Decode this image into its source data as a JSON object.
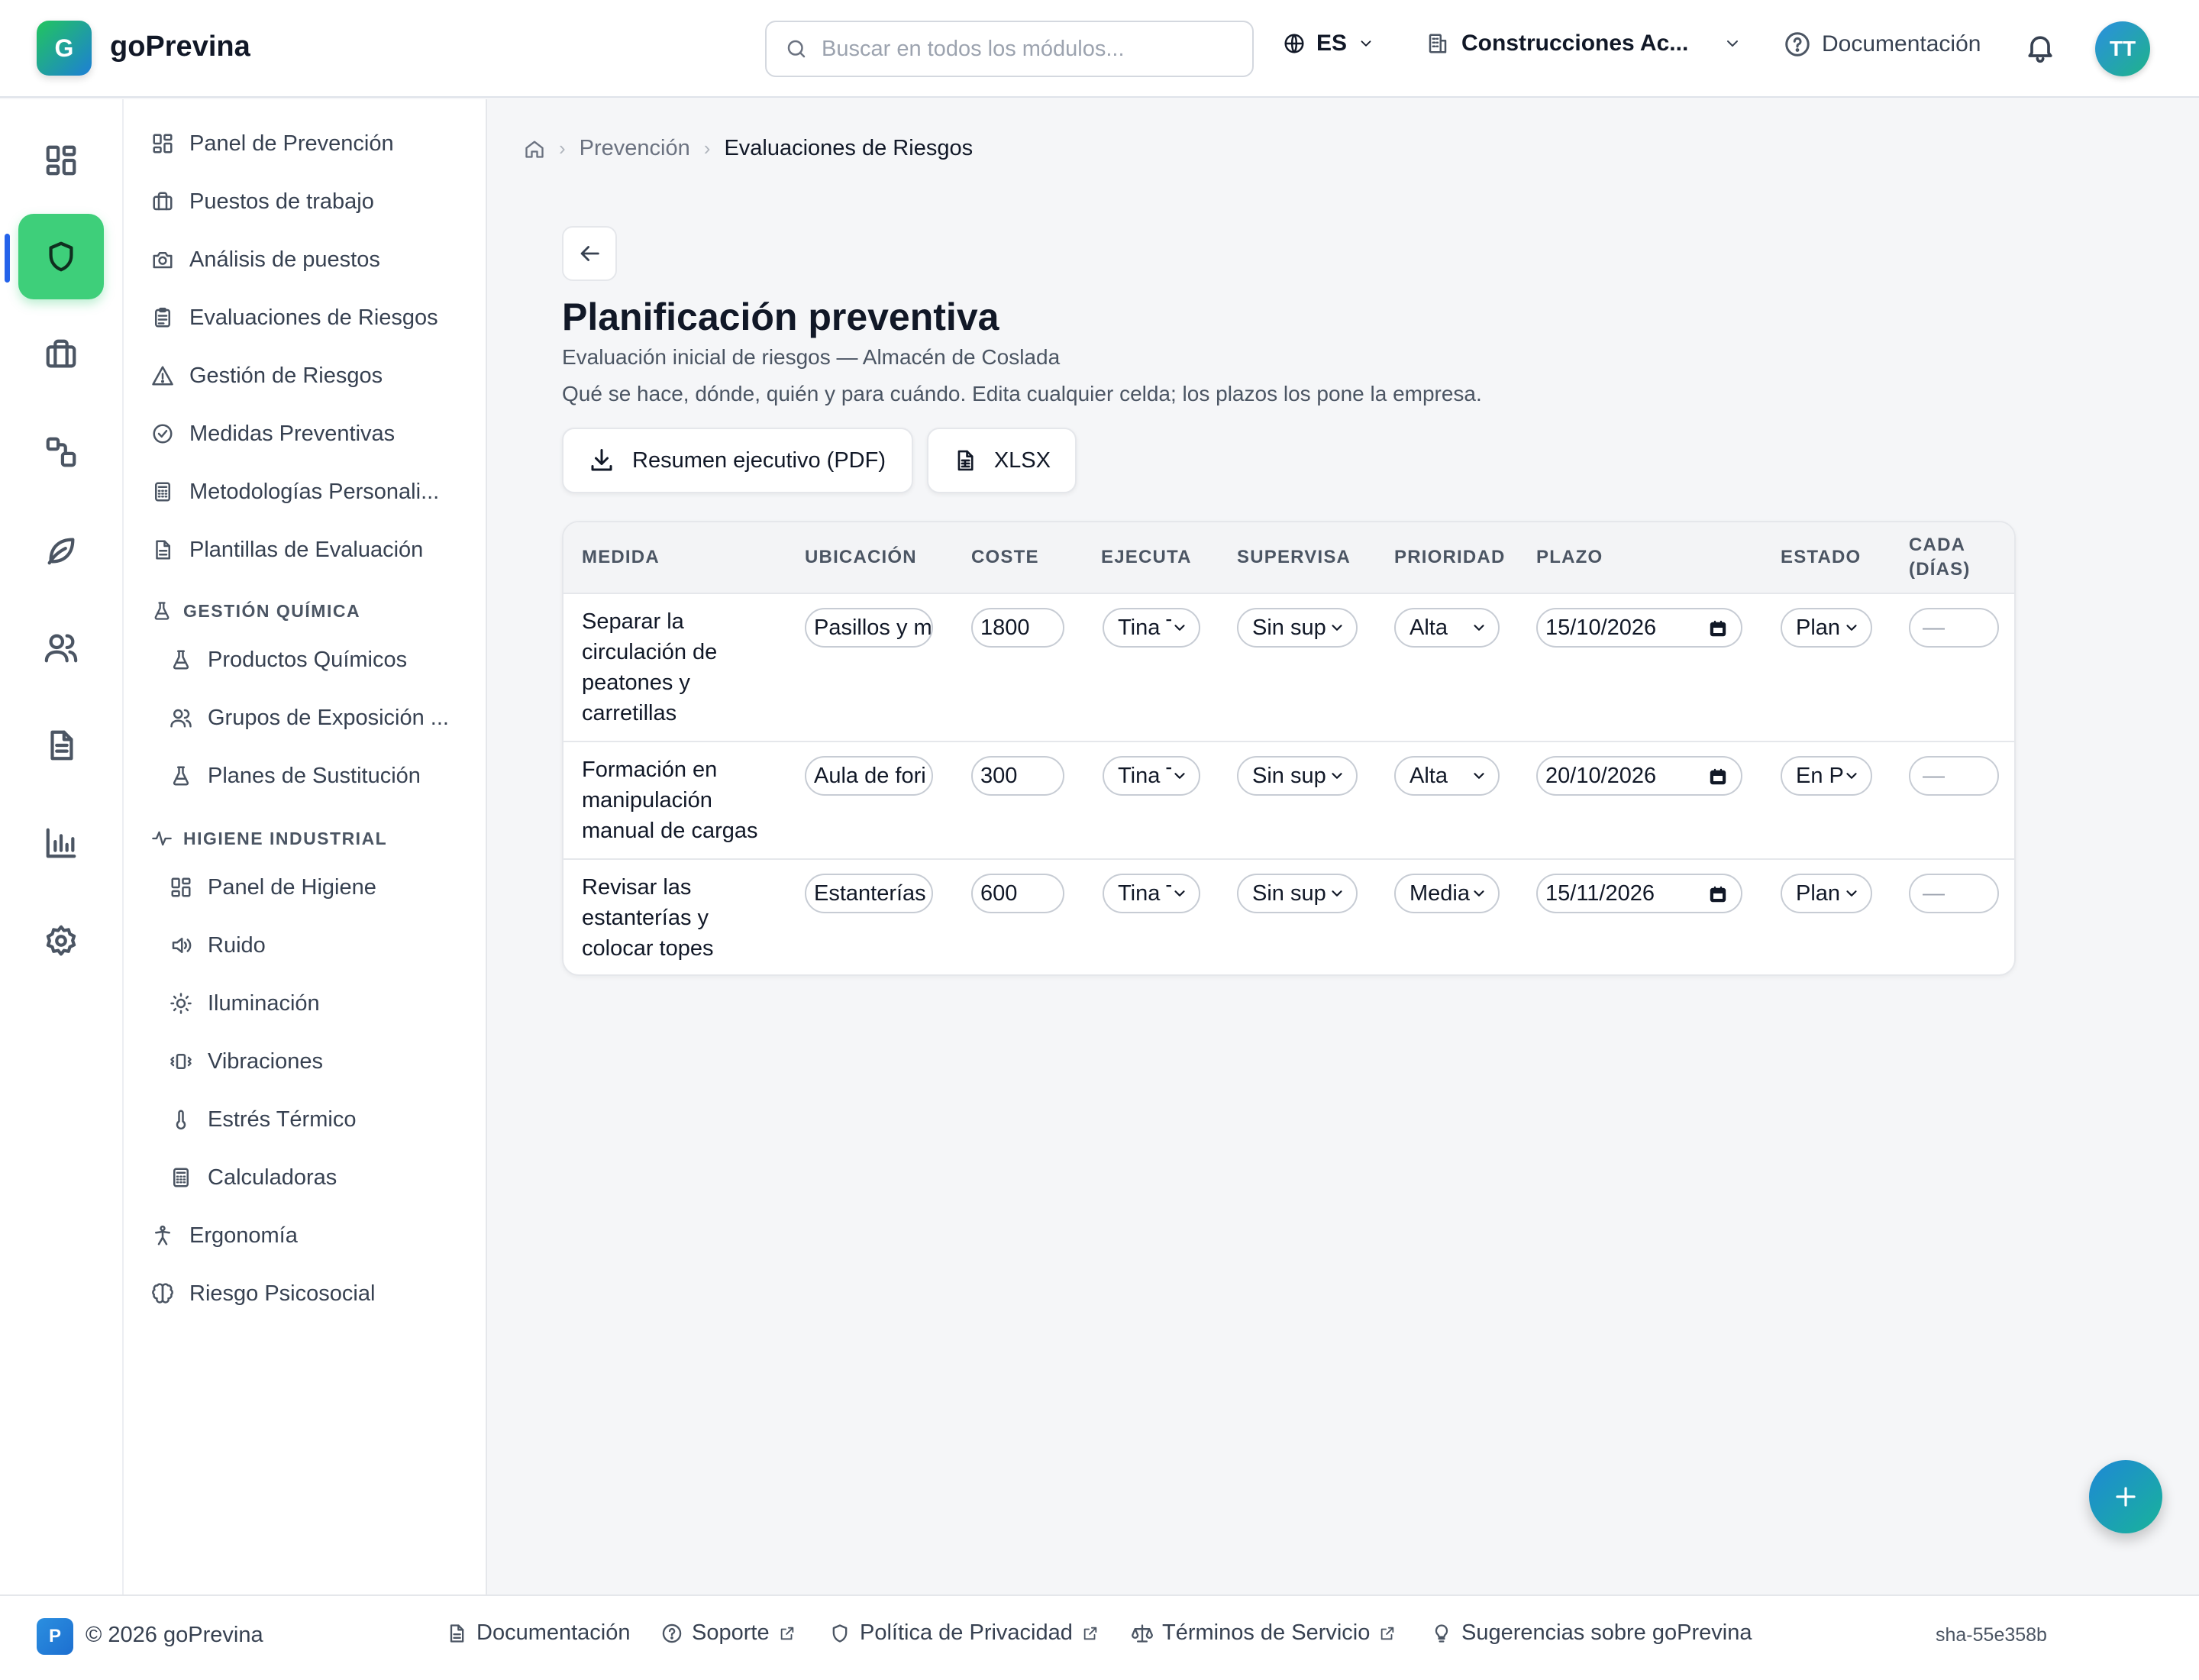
{
  "app": {
    "logo_letter": "G",
    "brand": "goPrevina",
    "search_placeholder": "Buscar en todos los módulos...",
    "language": "ES",
    "company": "Construcciones Ac...",
    "docs_label": "Documentación",
    "avatar_initials": "TT",
    "accent_color": "#3ecf7a",
    "indicator_color": "#2563eb"
  },
  "rail": {
    "items": [
      {
        "icon": "dashboard-icon"
      },
      {
        "icon": "shield-icon",
        "active": true
      },
      {
        "icon": "briefcase-icon"
      },
      {
        "icon": "shapes-icon"
      },
      {
        "icon": "leaf-icon"
      },
      {
        "icon": "users-icon"
      },
      {
        "icon": "document-icon"
      },
      {
        "icon": "bar-chart-icon"
      },
      {
        "icon": "settings-icon"
      }
    ]
  },
  "subnav": {
    "items": [
      {
        "label": "Panel de Prevención",
        "icon": "dashboard-icon"
      },
      {
        "label": "Puestos de trabajo",
        "icon": "briefcase-icon"
      },
      {
        "label": "Análisis de puestos",
        "icon": "camera-icon"
      },
      {
        "label": "Evaluaciones de Riesgos",
        "icon": "clipboard-icon"
      },
      {
        "label": "Gestión de Riesgos",
        "icon": "warning-icon"
      },
      {
        "label": "Medidas Preventivas",
        "icon": "check-circle-icon"
      },
      {
        "label": "Metodologías Personali...",
        "icon": "calculator-icon"
      },
      {
        "label": "Plantillas de Evaluación",
        "icon": "file-icon"
      }
    ],
    "quimica": {
      "title": "GESTIÓN QUÍMICA",
      "items": [
        {
          "label": "Productos Químicos",
          "icon": "flask-icon"
        },
        {
          "label": "Grupos de Exposición ...",
          "icon": "users-icon"
        },
        {
          "label": "Planes de Sustitución",
          "icon": "flask-icon"
        }
      ]
    },
    "higiene": {
      "title": "HIGIENE INDUSTRIAL",
      "items": [
        {
          "label": "Panel de Higiene",
          "icon": "dashboard-icon"
        },
        {
          "label": "Ruido",
          "icon": "speaker-icon"
        },
        {
          "label": "Iluminación",
          "icon": "sun-icon"
        },
        {
          "label": "Vibraciones",
          "icon": "vibration-icon"
        },
        {
          "label": "Estrés Térmico",
          "icon": "thermometer-icon"
        },
        {
          "label": "Calculadoras",
          "icon": "calculator-icon"
        }
      ]
    },
    "extra": [
      {
        "label": "Ergonomía",
        "icon": "person-icon"
      },
      {
        "label": "Riesgo Psicosocial",
        "icon": "brain-icon"
      }
    ]
  },
  "breadcrumb": {
    "home_icon": "home-icon",
    "level1": "Prevención",
    "current": "Evaluaciones de Riesgos"
  },
  "page": {
    "title": "Planificación preventiva",
    "subtitle": "Evaluación inicial de riesgos — Almacén de Coslada",
    "help": "Qué se hace, dónde, quién y para cuándo. Edita cualquier celda; los plazos los pone la empresa.",
    "btn_pdf": "Resumen ejecutivo (PDF)",
    "btn_xlsx": "XLSX"
  },
  "table": {
    "headers": {
      "medida": "MEDIDA",
      "ubicacion": "UBICACIÓN",
      "coste": "COSTE",
      "ejecuta": "EJECUTA",
      "supervisa": "SUPERVISA",
      "prioridad": "PRIORIDAD",
      "plazo": "PLAZO",
      "estado": "ESTADO",
      "cada_1": "CADA",
      "cada_2": "(DÍAS)"
    },
    "rows": [
      {
        "medida": [
          "Separar la",
          "circulación de",
          "peatones y",
          "carretillas"
        ],
        "ubicacion": "Pasillos y m",
        "coste": "1800",
        "ejecuta": "Tina T",
        "supervisa": "Sin sup",
        "prioridad": "Alta",
        "plazo": "15/10/2026",
        "estado": "Plan",
        "cada": "—"
      },
      {
        "medida": [
          "Formación en",
          "manipulación",
          "manual de cargas"
        ],
        "ubicacion": "Aula de fori",
        "coste": "300",
        "ejecuta": "Tina T",
        "supervisa": "Sin sup",
        "prioridad": "Alta",
        "plazo": "20/10/2026",
        "estado": "En P",
        "cada": "—"
      },
      {
        "medida": [
          "Revisar las",
          "estanterías y",
          "colocar topes"
        ],
        "ubicacion": "Estanterías",
        "coste": "600",
        "ejecuta": "Tina T",
        "supervisa": "Sin sup",
        "prioridad": "Media",
        "plazo": "15/11/2026",
        "estado": "Plan",
        "cada": "—"
      }
    ]
  },
  "footer": {
    "logo_letter": "P",
    "copyright": "© 2026 goPrevina",
    "docs": "Documentación",
    "support": "Soporte",
    "privacy": "Política de Privacidad",
    "terms": "Términos de Servicio",
    "suggestions": "Sugerencias sobre goPrevina",
    "sha": "sha-55e358b"
  }
}
